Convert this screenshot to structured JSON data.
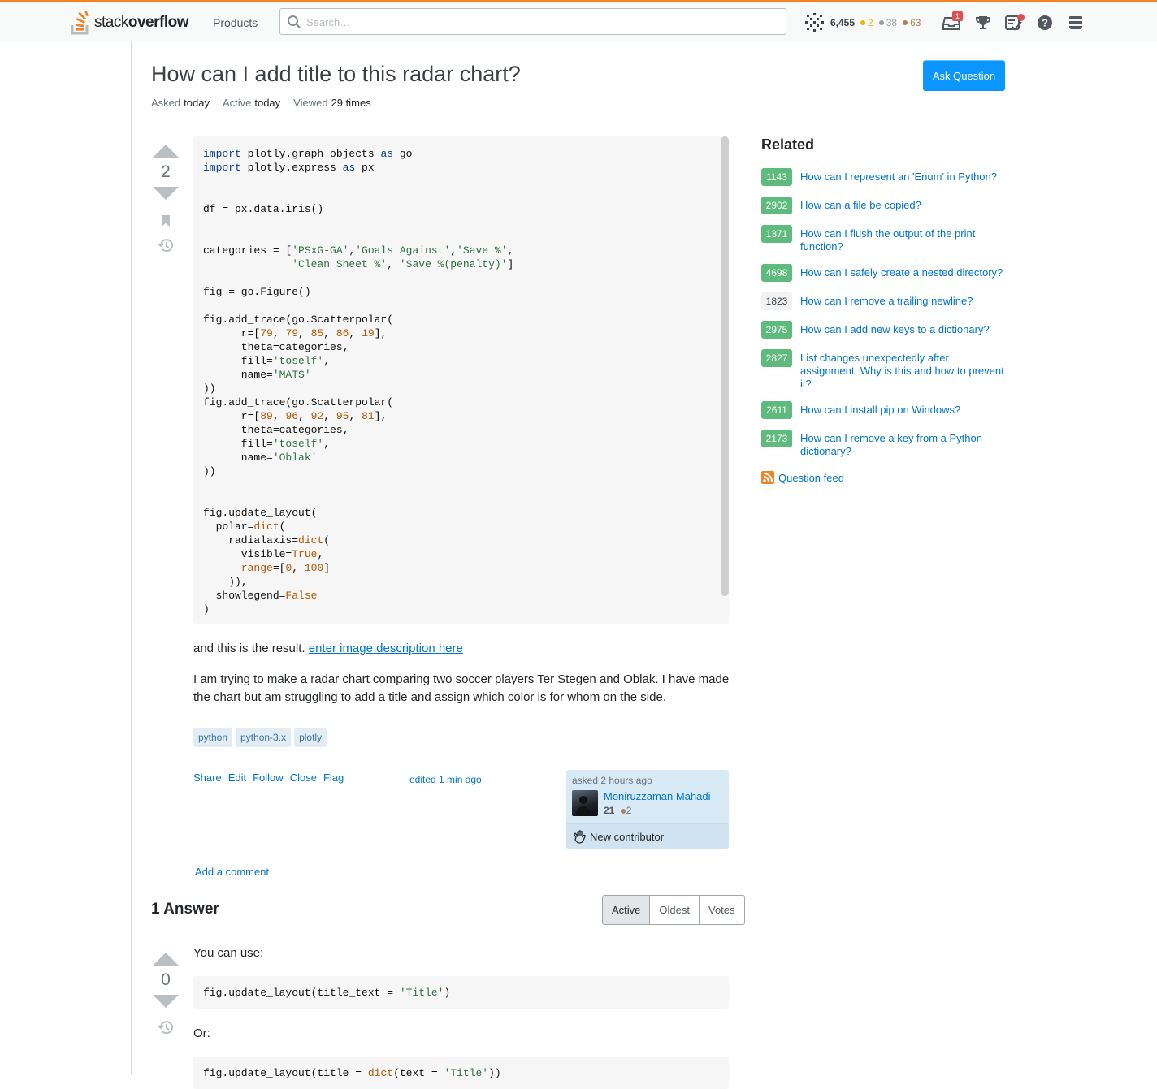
{
  "topbar": {
    "logo_light": "stack",
    "logo_bold": "overflow",
    "products_label": "Products",
    "search_placeholder": "Search…",
    "reputation": "6,455",
    "gold": "2",
    "silver": "38",
    "bronze": "63",
    "inbox_count": "1",
    "colors": {
      "accent": "#f48225",
      "gold": "#f1b600",
      "silver": "#9a9ea3",
      "bronze": "#ab825f"
    }
  },
  "question": {
    "title": "How can I add title to this radar chart?",
    "ask_button": "Ask Question",
    "asked_label": "Asked",
    "asked_value": "today",
    "active_label": "Active",
    "active_value": "today",
    "viewed_label": "Viewed",
    "viewed_value": "29 times",
    "votes": "2",
    "result_text": "and this is the result.",
    "image_link": "enter image description here",
    "body_text": "I am trying to make a radar chart comparing two soccer players Ter Stegen and Oblak. I have made the chart but am struggling to add a title and assign which color is for whom on the side.",
    "tags": [
      "python",
      "python-3.x",
      "plotly"
    ],
    "menu": [
      "Share",
      "Edit",
      "Follow",
      "Close",
      "Flag"
    ],
    "edited": "edited 1 min ago",
    "owner": {
      "asked": "asked 2 hours ago",
      "name": "Moniruzzaman Mahadi",
      "rep": "21",
      "bronze": "2",
      "new_contributor": "New contributor"
    },
    "add_comment": "Add a comment"
  },
  "answers": {
    "header": "1 Answer",
    "sort_tabs": [
      "Active",
      "Oldest",
      "Votes"
    ],
    "active_tab": "Active",
    "answer_votes": "0",
    "intro": "You can use:",
    "or_text": "Or:"
  },
  "sidebar": {
    "related_title": "Related",
    "related": [
      {
        "score": "1143",
        "title": "How can I represent an 'Enum' in Python?",
        "accepted": true
      },
      {
        "score": "2902",
        "title": "How can a file be copied?",
        "accepted": true
      },
      {
        "score": "1371",
        "title": "How can I flush the output of the print function?",
        "accepted": true
      },
      {
        "score": "4698",
        "title": "How can I safely create a nested directory?",
        "accepted": true
      },
      {
        "score": "1823",
        "title": "How can I remove a trailing newline?",
        "accepted": false
      },
      {
        "score": "2975",
        "title": "How can I add new keys to a dictionary?",
        "accepted": true
      },
      {
        "score": "2827",
        "title": "List changes unexpectedly after assignment. Why is this and how to prevent it?",
        "accepted": true
      },
      {
        "score": "2611",
        "title": "How can I install pip on Windows?",
        "accepted": true
      },
      {
        "score": "2173",
        "title": "How can I remove a key from a Python dictionary?",
        "accepted": true
      }
    ],
    "feed_label": "Question feed"
  }
}
